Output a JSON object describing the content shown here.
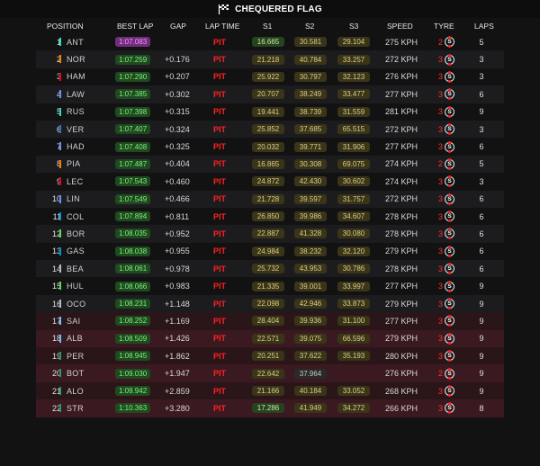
{
  "header": {
    "title": "CHEQUERED FLAG"
  },
  "columns": {
    "position": "POSITION",
    "best": "BEST LAP",
    "gap": "GAP",
    "laptime": "LAP TIME",
    "s1": "S1",
    "s2": "S2",
    "s3": "S3",
    "speed": "SPEED",
    "tyre": "TYRE",
    "laps": "LAPS"
  },
  "colors": {
    "pit": "#ff2222",
    "fastest": "#6e2f7a",
    "best": "#1f4a1f"
  },
  "rows": [
    {
      "pos": "1",
      "driver": "ANT",
      "team": "#27e0c4",
      "best": "1:07.083",
      "purple": true,
      "gap": "",
      "lt": "PIT",
      "s1": "16.665",
      "s1c": "g",
      "s2": "30.581",
      "s2c": "y",
      "s3": "29.104",
      "s3c": "y",
      "speed": "275 KPH",
      "tn": "2",
      "tyre": "S",
      "laps": "5",
      "red": false
    },
    {
      "pos": "2",
      "driver": "NOR",
      "team": "#ff8000",
      "best": "1:07.259",
      "gap": "+0.176",
      "lt": "PIT",
      "s1": "21.218",
      "s1c": "y",
      "s2": "40.784",
      "s2c": "y",
      "s3": "33.257",
      "s3c": "y",
      "speed": "272 KPH",
      "tn": "3",
      "tyre": "S",
      "laps": "3",
      "red": false
    },
    {
      "pos": "3",
      "driver": "HAM",
      "team": "#e8002d",
      "best": "1:07.290",
      "gap": "+0.207",
      "lt": "PIT",
      "s1": "25.922",
      "s1c": "y",
      "s2": "30.797",
      "s2c": "y",
      "s3": "32.123",
      "s3c": "y",
      "speed": "276 KPH",
      "tn": "3",
      "tyre": "S",
      "laps": "3",
      "red": false
    },
    {
      "pos": "4",
      "driver": "LAW",
      "team": "#6692ff",
      "best": "1:07.385",
      "gap": "+0.302",
      "lt": "PIT",
      "s1": "20.707",
      "s1c": "y",
      "s2": "38.249",
      "s2c": "y",
      "s3": "33.477",
      "s3c": "y",
      "speed": "277 KPH",
      "tn": "3",
      "tyre": "S",
      "laps": "6",
      "red": false
    },
    {
      "pos": "5",
      "driver": "RUS",
      "team": "#27e0c4",
      "best": "1:07.398",
      "gap": "+0.315",
      "lt": "PIT",
      "s1": "19.441",
      "s1c": "y",
      "s2": "38.739",
      "s2c": "y",
      "s3": "31.559",
      "s3c": "y",
      "speed": "281 KPH",
      "tn": "3",
      "tyre": "S",
      "laps": "9",
      "red": false
    },
    {
      "pos": "6",
      "driver": "VER",
      "team": "#3671c6",
      "best": "1:07.407",
      "gap": "+0.324",
      "lt": "PIT",
      "s1": "25.852",
      "s1c": "y",
      "s2": "37.685",
      "s2c": "y",
      "s3": "65.515",
      "s3c": "y",
      "speed": "272 KPH",
      "tn": "3",
      "tyre": "S",
      "laps": "3",
      "red": false
    },
    {
      "pos": "7",
      "driver": "HAD",
      "team": "#6692ff",
      "best": "1:07.408",
      "gap": "+0.325",
      "lt": "PIT",
      "s1": "20.032",
      "s1c": "y",
      "s2": "39.771",
      "s2c": "y",
      "s3": "31.906",
      "s3c": "y",
      "speed": "277 KPH",
      "tn": "3",
      "tyre": "S",
      "laps": "6",
      "red": false
    },
    {
      "pos": "8",
      "driver": "PIA",
      "team": "#ff8000",
      "best": "1:07.487",
      "gap": "+0.404",
      "lt": "PIT",
      "s1": "16.865",
      "s1c": "y",
      "s2": "30.308",
      "s2c": "y",
      "s3": "69.075",
      "s3c": "y",
      "speed": "274 KPH",
      "tn": "2",
      "tyre": "S",
      "laps": "5",
      "red": false
    },
    {
      "pos": "9",
      "driver": "LEC",
      "team": "#e8002d",
      "best": "1:07.543",
      "gap": "+0.460",
      "lt": "PIT",
      "s1": "24.872",
      "s1c": "y",
      "s2": "42.430",
      "s2c": "y",
      "s3": "30.602",
      "s3c": "y",
      "speed": "274 KPH",
      "tn": "3",
      "tyre": "S",
      "laps": "3",
      "red": false
    },
    {
      "pos": "10",
      "driver": "LIN",
      "team": "#6692ff",
      "best": "1:07.549",
      "gap": "+0.466",
      "lt": "PIT",
      "s1": "21.728",
      "s1c": "y",
      "s2": "39.597",
      "s2c": "y",
      "s3": "31.757",
      "s3c": "y",
      "speed": "272 KPH",
      "tn": "3",
      "tyre": "S",
      "laps": "6",
      "red": false
    },
    {
      "pos": "11",
      "driver": "COL",
      "team": "#0093cc",
      "best": "1:07.894",
      "gap": "+0.811",
      "lt": "PIT",
      "s1": "26.850",
      "s1c": "y",
      "s2": "39.986",
      "s2c": "y",
      "s3": "34.607",
      "s3c": "y",
      "speed": "278 KPH",
      "tn": "3",
      "tyre": "S",
      "laps": "6",
      "red": false
    },
    {
      "pos": "12",
      "driver": "BOR",
      "team": "#52e252",
      "best": "1:08.035",
      "gap": "+0.952",
      "lt": "PIT",
      "s1": "22.887",
      "s1c": "y",
      "s2": "41.328",
      "s2c": "y",
      "s3": "30.080",
      "s3c": "y",
      "speed": "278 KPH",
      "tn": "3",
      "tyre": "S",
      "laps": "6",
      "red": false
    },
    {
      "pos": "13",
      "driver": "GAS",
      "team": "#0093cc",
      "best": "1:08.038",
      "gap": "+0.955",
      "lt": "PIT",
      "s1": "24.984",
      "s1c": "y",
      "s2": "38.232",
      "s2c": "y",
      "s3": "32.120",
      "s3c": "y",
      "speed": "279 KPH",
      "tn": "3",
      "tyre": "S",
      "laps": "6",
      "red": false
    },
    {
      "pos": "14",
      "driver": "BEA",
      "team": "#b6babd",
      "best": "1:08.061",
      "gap": "+0.978",
      "lt": "PIT",
      "s1": "25.732",
      "s1c": "y",
      "s2": "43.953",
      "s2c": "y",
      "s3": "30.786",
      "s3c": "y",
      "speed": "278 KPH",
      "tn": "3",
      "tyre": "S",
      "laps": "6",
      "red": false
    },
    {
      "pos": "15",
      "driver": "HUL",
      "team": "#52e252",
      "best": "1:08.066",
      "gap": "+0.983",
      "lt": "PIT",
      "s1": "21.335",
      "s1c": "y",
      "s2": "39.001",
      "s2c": "y",
      "s3": "33.997",
      "s3c": "y",
      "speed": "277 KPH",
      "tn": "3",
      "tyre": "S",
      "laps": "9",
      "red": false
    },
    {
      "pos": "16",
      "driver": "OCO",
      "team": "#b6babd",
      "best": "1:08.231",
      "gap": "+1.148",
      "lt": "PIT",
      "s1": "22.098",
      "s1c": "y",
      "s2": "42.946",
      "s2c": "y",
      "s3": "33.873",
      "s3c": "y",
      "speed": "279 KPH",
      "tn": "3",
      "tyre": "S",
      "laps": "9",
      "red": false
    },
    {
      "pos": "17",
      "driver": "SAI",
      "team": "#64c4ff",
      "best": "1:08.252",
      "gap": "+1.169",
      "lt": "PIT",
      "s1": "28.404",
      "s1c": "y",
      "s2": "39.936",
      "s2c": "y",
      "s3": "31.100",
      "s3c": "y",
      "speed": "277 KPH",
      "tn": "3",
      "tyre": "S",
      "laps": "9",
      "red": true
    },
    {
      "pos": "18",
      "driver": "ALB",
      "team": "#64c4ff",
      "best": "1:08.509",
      "gap": "+1.426",
      "lt": "PIT",
      "s1": "22.571",
      "s1c": "y",
      "s2": "39.075",
      "s2c": "y",
      "s3": "66.596",
      "s3c": "y",
      "speed": "279 KPH",
      "tn": "3",
      "tyre": "S",
      "laps": "9",
      "red": true
    },
    {
      "pos": "19",
      "driver": "PER",
      "team": "#229971",
      "best": "1:08.945",
      "gap": "+1.862",
      "lt": "PIT",
      "s1": "20.251",
      "s1c": "y",
      "s2": "37.622",
      "s2c": "y",
      "s3": "35.193",
      "s3c": "y",
      "speed": "280 KPH",
      "tn": "3",
      "tyre": "S",
      "laps": "9",
      "red": true
    },
    {
      "pos": "20",
      "driver": "BOT",
      "team": "#229971",
      "best": "1:09.030",
      "gap": "+1.947",
      "lt": "PIT",
      "s1": "22.642",
      "s1c": "y",
      "s2": "37.964",
      "s2c": "n",
      "s3": "",
      "s3c": "",
      "speed": "276 KPH",
      "tn": "2",
      "tyre": "S",
      "laps": "9",
      "red": true
    },
    {
      "pos": "21",
      "driver": "ALO",
      "team": "#229971",
      "best": "1:09.942",
      "gap": "+2.859",
      "lt": "PIT",
      "s1": "21.166",
      "s1c": "y",
      "s2": "40.184",
      "s2c": "y",
      "s3": "33.052",
      "s3c": "y",
      "speed": "268 KPH",
      "tn": "3",
      "tyre": "S",
      "laps": "9",
      "red": true
    },
    {
      "pos": "22",
      "driver": "STR",
      "team": "#229971",
      "best": "1:10.363",
      "gap": "+3.280",
      "lt": "PIT",
      "s1": "17.286",
      "s1c": "g",
      "s2": "41.949",
      "s2c": "y",
      "s3": "34.272",
      "s3c": "y",
      "speed": "266 KPH",
      "tn": "3",
      "tyre": "S",
      "laps": "8",
      "red": true
    }
  ]
}
